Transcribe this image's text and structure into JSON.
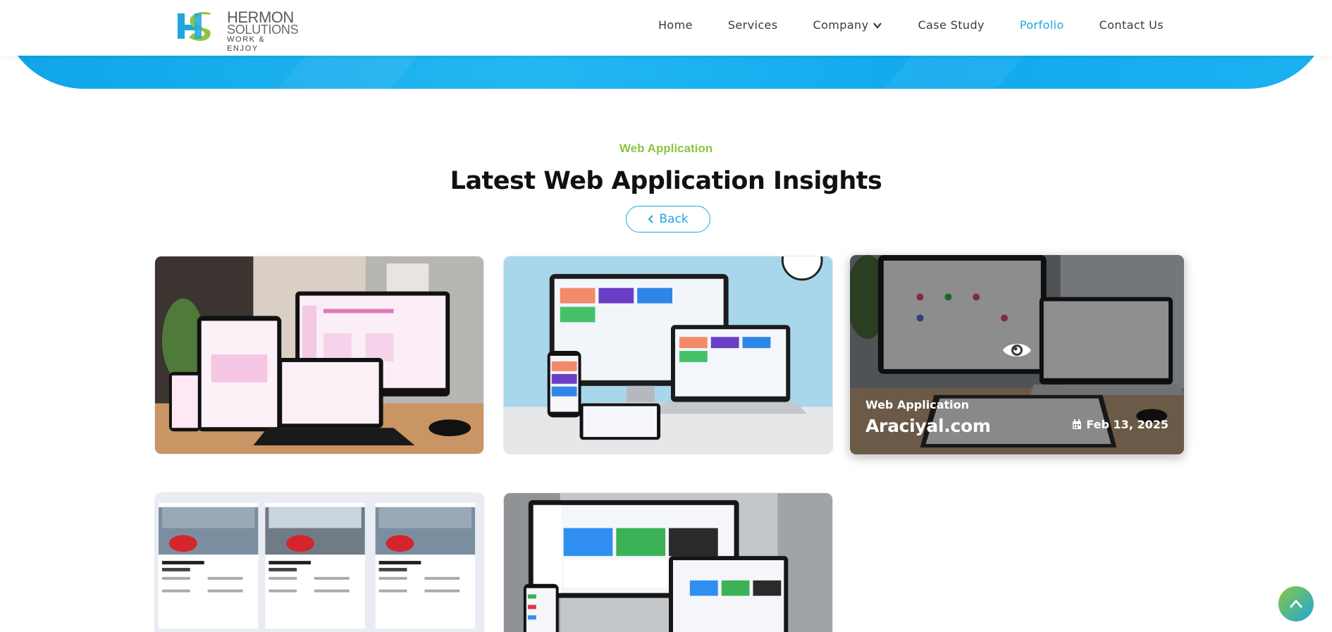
{
  "brand": {
    "logo_line1": "HERMON",
    "logo_line2": "SOLUTIONS",
    "logo_line3": "WORK & ENJOY",
    "primary_color": "#1ea7de",
    "accent_color": "#8cc63f"
  },
  "nav": {
    "items": [
      {
        "label": "Home"
      },
      {
        "label": "Services"
      },
      {
        "label": "Company"
      },
      {
        "label": "Case Study"
      },
      {
        "label": "Porfolio"
      },
      {
        "label": "Contact Us"
      }
    ],
    "active": "Porfolio",
    "dropdown_icon": "chevron-down-icon"
  },
  "section": {
    "eyebrow": "Web Application",
    "title": "Latest Web Application Insights",
    "back_label": "Back",
    "back_icon": "chevron-left-icon"
  },
  "cards": [
    {
      "image": "pink dashboard on monitor, laptop, tablet and phone"
    },
    {
      "image": "colorful dashboard on monitor, laptop, tablet and phone"
    },
    {
      "category": "Web Application",
      "title": "Araciyal.com",
      "date": "Feb 13, 2025",
      "hover_icon": "eye-icon",
      "date_icon": "calendar-icon"
    },
    {
      "image": "vehicle listing cards"
    },
    {
      "image": "analytics dashboard on monitor, laptop and phone"
    }
  ],
  "scroll_top": {
    "icon": "chevron-up-icon"
  }
}
